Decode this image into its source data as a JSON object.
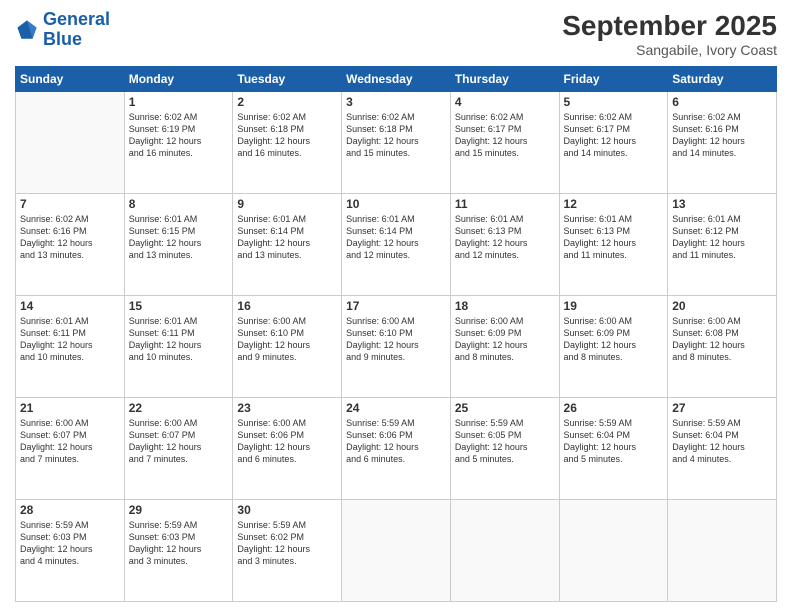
{
  "logo": {
    "line1": "General",
    "line2": "Blue"
  },
  "title": "September 2025",
  "location": "Sangabile, Ivory Coast",
  "days_header": [
    "Sunday",
    "Monday",
    "Tuesday",
    "Wednesday",
    "Thursday",
    "Friday",
    "Saturday"
  ],
  "weeks": [
    [
      {
        "num": "",
        "info": ""
      },
      {
        "num": "1",
        "info": "Sunrise: 6:02 AM\nSunset: 6:19 PM\nDaylight: 12 hours\nand 16 minutes."
      },
      {
        "num": "2",
        "info": "Sunrise: 6:02 AM\nSunset: 6:18 PM\nDaylight: 12 hours\nand 16 minutes."
      },
      {
        "num": "3",
        "info": "Sunrise: 6:02 AM\nSunset: 6:18 PM\nDaylight: 12 hours\nand 15 minutes."
      },
      {
        "num": "4",
        "info": "Sunrise: 6:02 AM\nSunset: 6:17 PM\nDaylight: 12 hours\nand 15 minutes."
      },
      {
        "num": "5",
        "info": "Sunrise: 6:02 AM\nSunset: 6:17 PM\nDaylight: 12 hours\nand 14 minutes."
      },
      {
        "num": "6",
        "info": "Sunrise: 6:02 AM\nSunset: 6:16 PM\nDaylight: 12 hours\nand 14 minutes."
      }
    ],
    [
      {
        "num": "7",
        "info": "Sunrise: 6:02 AM\nSunset: 6:16 PM\nDaylight: 12 hours\nand 13 minutes."
      },
      {
        "num": "8",
        "info": "Sunrise: 6:01 AM\nSunset: 6:15 PM\nDaylight: 12 hours\nand 13 minutes."
      },
      {
        "num": "9",
        "info": "Sunrise: 6:01 AM\nSunset: 6:14 PM\nDaylight: 12 hours\nand 13 minutes."
      },
      {
        "num": "10",
        "info": "Sunrise: 6:01 AM\nSunset: 6:14 PM\nDaylight: 12 hours\nand 12 minutes."
      },
      {
        "num": "11",
        "info": "Sunrise: 6:01 AM\nSunset: 6:13 PM\nDaylight: 12 hours\nand 12 minutes."
      },
      {
        "num": "12",
        "info": "Sunrise: 6:01 AM\nSunset: 6:13 PM\nDaylight: 12 hours\nand 11 minutes."
      },
      {
        "num": "13",
        "info": "Sunrise: 6:01 AM\nSunset: 6:12 PM\nDaylight: 12 hours\nand 11 minutes."
      }
    ],
    [
      {
        "num": "14",
        "info": "Sunrise: 6:01 AM\nSunset: 6:11 PM\nDaylight: 12 hours\nand 10 minutes."
      },
      {
        "num": "15",
        "info": "Sunrise: 6:01 AM\nSunset: 6:11 PM\nDaylight: 12 hours\nand 10 minutes."
      },
      {
        "num": "16",
        "info": "Sunrise: 6:00 AM\nSunset: 6:10 PM\nDaylight: 12 hours\nand 9 minutes."
      },
      {
        "num": "17",
        "info": "Sunrise: 6:00 AM\nSunset: 6:10 PM\nDaylight: 12 hours\nand 9 minutes."
      },
      {
        "num": "18",
        "info": "Sunrise: 6:00 AM\nSunset: 6:09 PM\nDaylight: 12 hours\nand 8 minutes."
      },
      {
        "num": "19",
        "info": "Sunrise: 6:00 AM\nSunset: 6:09 PM\nDaylight: 12 hours\nand 8 minutes."
      },
      {
        "num": "20",
        "info": "Sunrise: 6:00 AM\nSunset: 6:08 PM\nDaylight: 12 hours\nand 8 minutes."
      }
    ],
    [
      {
        "num": "21",
        "info": "Sunrise: 6:00 AM\nSunset: 6:07 PM\nDaylight: 12 hours\nand 7 minutes."
      },
      {
        "num": "22",
        "info": "Sunrise: 6:00 AM\nSunset: 6:07 PM\nDaylight: 12 hours\nand 7 minutes."
      },
      {
        "num": "23",
        "info": "Sunrise: 6:00 AM\nSunset: 6:06 PM\nDaylight: 12 hours\nand 6 minutes."
      },
      {
        "num": "24",
        "info": "Sunrise: 5:59 AM\nSunset: 6:06 PM\nDaylight: 12 hours\nand 6 minutes."
      },
      {
        "num": "25",
        "info": "Sunrise: 5:59 AM\nSunset: 6:05 PM\nDaylight: 12 hours\nand 5 minutes."
      },
      {
        "num": "26",
        "info": "Sunrise: 5:59 AM\nSunset: 6:04 PM\nDaylight: 12 hours\nand 5 minutes."
      },
      {
        "num": "27",
        "info": "Sunrise: 5:59 AM\nSunset: 6:04 PM\nDaylight: 12 hours\nand 4 minutes."
      }
    ],
    [
      {
        "num": "28",
        "info": "Sunrise: 5:59 AM\nSunset: 6:03 PM\nDaylight: 12 hours\nand 4 minutes."
      },
      {
        "num": "29",
        "info": "Sunrise: 5:59 AM\nSunset: 6:03 PM\nDaylight: 12 hours\nand 3 minutes."
      },
      {
        "num": "30",
        "info": "Sunrise: 5:59 AM\nSunset: 6:02 PM\nDaylight: 12 hours\nand 3 minutes."
      },
      {
        "num": "",
        "info": ""
      },
      {
        "num": "",
        "info": ""
      },
      {
        "num": "",
        "info": ""
      },
      {
        "num": "",
        "info": ""
      }
    ]
  ]
}
